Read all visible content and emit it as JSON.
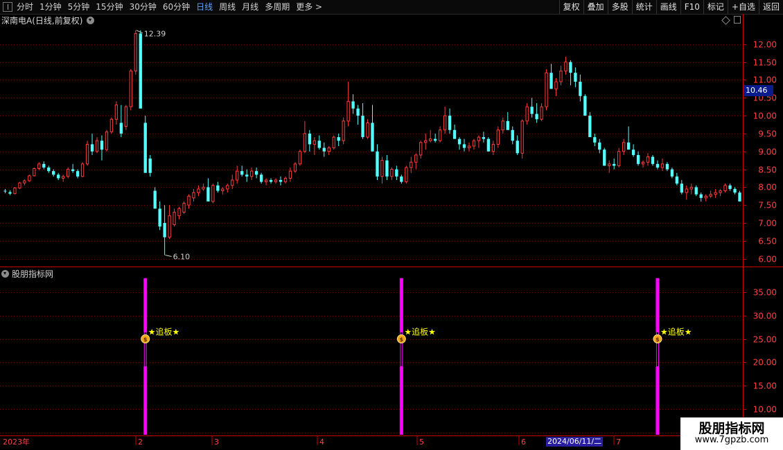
{
  "toolbar": {
    "periods": [
      "分时",
      "1分钟",
      "5分钟",
      "15分钟",
      "30分钟",
      "60分钟",
      "日线",
      "周线",
      "月线",
      "多周期",
      "更多 >"
    ],
    "active_period": "日线",
    "actions": [
      "复权",
      "叠加",
      "多股",
      "统计",
      "画线",
      "F10",
      "标记",
      "+自选",
      "返回"
    ]
  },
  "chart_title": "深南电A(日线,前复权)",
  "indicator_title": "股朋指标网",
  "current_price_badge": "10.46",
  "high_label": "12.39",
  "low_label": "6.10",
  "signal_label": "★追板★",
  "date_badge": "2024/06/11/二",
  "x_labels": [
    "2023年",
    "2",
    "3",
    "4",
    "5",
    "6",
    "7"
  ],
  "watermark": {
    "title": "股朋指标网",
    "url": "www.7gpzb.com"
  },
  "colors": {
    "up": "#ff3b3b",
    "down": "#54ffff",
    "grid": "#7a0000",
    "axis": "#c80000",
    "signal": "#ff00ff",
    "label": "#ffff00"
  },
  "chart_data": [
    {
      "type": "candlestick",
      "title": "深南电A(日线,前复权)",
      "y_ticks": [
        6.0,
        6.5,
        7.0,
        7.5,
        8.0,
        8.5,
        9.0,
        9.5,
        10.0,
        10.5,
        11.0,
        11.5,
        12.0
      ],
      "ylim": [
        5.8,
        12.5
      ],
      "x_ticks": [
        "2023年",
        "2",
        "3",
        "4",
        "5",
        "6",
        "7"
      ],
      "annotations": {
        "high": 12.39,
        "low": 6.1,
        "last_price": 10.46
      },
      "candles": [
        [
          7.9,
          7.95,
          7.83,
          7.88
        ],
        [
          7.86,
          7.91,
          7.78,
          7.82
        ],
        [
          7.82,
          8.0,
          7.8,
          7.98
        ],
        [
          7.98,
          8.15,
          7.95,
          8.12
        ],
        [
          8.12,
          8.22,
          8.05,
          8.18
        ],
        [
          8.18,
          8.35,
          8.15,
          8.32
        ],
        [
          8.32,
          8.55,
          8.3,
          8.52
        ],
        [
          8.52,
          8.7,
          8.48,
          8.65
        ],
        [
          8.65,
          8.72,
          8.5,
          8.55
        ],
        [
          8.55,
          8.6,
          8.4,
          8.45
        ],
        [
          8.45,
          8.5,
          8.3,
          8.35
        ],
        [
          8.35,
          8.4,
          8.2,
          8.25
        ],
        [
          8.25,
          8.35,
          8.15,
          8.3
        ],
        [
          8.3,
          8.55,
          8.25,
          8.5
        ],
        [
          8.5,
          8.65,
          8.4,
          8.45
        ],
        [
          8.45,
          8.5,
          8.25,
          8.3
        ],
        [
          8.3,
          8.7,
          8.28,
          8.65
        ],
        [
          8.65,
          9.3,
          8.6,
          9.2
        ],
        [
          9.2,
          9.5,
          8.9,
          9.0
        ],
        [
          9.0,
          9.4,
          8.95,
          9.3
        ],
        [
          9.3,
          9.45,
          8.75,
          9.05
        ],
        [
          9.05,
          9.6,
          9.0,
          9.55
        ],
        [
          9.55,
          9.95,
          9.5,
          9.9
        ],
        [
          9.9,
          10.4,
          9.75,
          10.3
        ],
        [
          9.8,
          10.3,
          9.4,
          9.5
        ],
        [
          9.7,
          10.3,
          9.6,
          10.25
        ],
        [
          10.25,
          11.3,
          10.15,
          11.25
        ],
        [
          11.25,
          12.39,
          11.15,
          12.3
        ],
        [
          12.3,
          12.39,
          10.5,
          10.2
        ],
        [
          9.8,
          10.0,
          8.5,
          8.4
        ],
        [
          8.8,
          8.9,
          8.3,
          8.4
        ],
        [
          7.9,
          8.0,
          7.4,
          7.4
        ],
        [
          7.4,
          7.6,
          6.8,
          6.9
        ],
        [
          7.0,
          7.5,
          6.1,
          6.6
        ],
        [
          6.6,
          7.5,
          6.55,
          7.2
        ],
        [
          6.95,
          7.4,
          6.9,
          7.3
        ],
        [
          7.2,
          7.45,
          7.1,
          7.4
        ],
        [
          7.3,
          7.6,
          7.25,
          7.55
        ],
        [
          7.5,
          7.8,
          7.4,
          7.75
        ],
        [
          7.7,
          7.95,
          7.6,
          7.85
        ],
        [
          7.85,
          8.05,
          7.75,
          7.95
        ],
        [
          7.95,
          8.1,
          7.9,
          8.0
        ],
        [
          8.0,
          8.25,
          7.95,
          7.6
        ],
        [
          7.6,
          8.1,
          7.55,
          8.05
        ],
        [
          8.05,
          8.15,
          7.85,
          7.9
        ],
        [
          7.9,
          8.0,
          7.8,
          7.95
        ],
        [
          7.95,
          8.1,
          7.85,
          8.05
        ],
        [
          8.05,
          8.35,
          7.95,
          8.2
        ],
        [
          8.2,
          8.6,
          8.1,
          8.45
        ],
        [
          8.45,
          8.6,
          8.3,
          8.35
        ],
        [
          8.35,
          8.5,
          8.15,
          8.3
        ],
        [
          8.3,
          8.55,
          8.2,
          8.45
        ],
        [
          8.45,
          8.55,
          8.25,
          8.35
        ],
        [
          8.35,
          8.4,
          8.1,
          8.15
        ],
        [
          8.15,
          8.25,
          8.05,
          8.2
        ],
        [
          8.2,
          8.25,
          8.1,
          8.15
        ],
        [
          8.15,
          8.25,
          8.1,
          8.2
        ],
        [
          8.2,
          8.3,
          8.05,
          8.15
        ],
        [
          8.15,
          8.3,
          8.1,
          8.25
        ],
        [
          8.25,
          8.55,
          8.15,
          8.45
        ],
        [
          8.45,
          8.7,
          8.4,
          8.65
        ],
        [
          8.65,
          9.05,
          8.6,
          9.0
        ],
        [
          9.0,
          9.85,
          8.95,
          9.5
        ],
        [
          9.5,
          9.6,
          9.0,
          9.2
        ],
        [
          9.2,
          9.4,
          8.9,
          9.3
        ],
        [
          9.3,
          9.45,
          9.05,
          9.1
        ],
        [
          9.1,
          9.25,
          8.85,
          9.0
        ],
        [
          9.0,
          9.15,
          8.9,
          9.1
        ],
        [
          9.1,
          9.45,
          9.05,
          9.4
        ],
        [
          9.4,
          9.5,
          9.15,
          9.3
        ],
        [
          9.3,
          9.95,
          9.2,
          9.85
        ],
        [
          9.85,
          10.95,
          9.7,
          10.4
        ],
        [
          10.4,
          10.6,
          10.05,
          10.2
        ],
        [
          10.2,
          10.3,
          9.75,
          10.0
        ],
        [
          10.0,
          10.35,
          9.35,
          9.4
        ],
        [
          9.4,
          9.9,
          9.35,
          9.8
        ],
        [
          9.8,
          10.3,
          9.0,
          9.0
        ],
        [
          9.0,
          9.2,
          8.2,
          8.3
        ],
        [
          8.3,
          8.85,
          8.1,
          8.75
        ],
        [
          8.75,
          8.9,
          8.2,
          8.3
        ],
        [
          8.3,
          8.55,
          8.2,
          8.5
        ],
        [
          8.5,
          8.6,
          8.2,
          8.3
        ],
        [
          8.3,
          8.35,
          8.1,
          8.15
        ],
        [
          8.15,
          8.6,
          8.1,
          8.55
        ],
        [
          8.55,
          8.85,
          8.4,
          8.7
        ],
        [
          8.7,
          8.95,
          8.5,
          8.9
        ],
        [
          8.9,
          9.3,
          8.8,
          9.25
        ],
        [
          9.25,
          9.5,
          9.05,
          9.3
        ],
        [
          9.3,
          9.6,
          9.25,
          9.35
        ],
        [
          9.35,
          9.5,
          9.25,
          9.3
        ],
        [
          9.3,
          9.7,
          9.25,
          9.6
        ],
        [
          9.6,
          10.25,
          9.5,
          10.0
        ],
        [
          10.0,
          10.2,
          9.5,
          9.6
        ],
        [
          9.6,
          9.75,
          9.4,
          9.35
        ],
        [
          9.35,
          9.4,
          9.05,
          9.2
        ],
        [
          9.2,
          9.35,
          9.0,
          9.1
        ],
        [
          9.1,
          9.25,
          9.0,
          9.15
        ],
        [
          9.15,
          9.35,
          9.05,
          9.3
        ],
        [
          9.3,
          9.45,
          9.1,
          9.4
        ],
        [
          9.4,
          9.55,
          9.25,
          9.35
        ],
        [
          9.35,
          9.4,
          9.0,
          9.0
        ],
        [
          9.0,
          9.3,
          8.9,
          9.2
        ],
        [
          9.2,
          9.7,
          9.1,
          9.6
        ],
        [
          9.6,
          9.95,
          9.5,
          9.85
        ],
        [
          9.85,
          10.1,
          9.7,
          9.6
        ],
        [
          9.6,
          9.7,
          9.2,
          9.3
        ],
        [
          9.3,
          9.45,
          8.9,
          8.95
        ],
        [
          8.95,
          9.9,
          8.8,
          9.85
        ],
        [
          9.85,
          10.35,
          9.75,
          10.25
        ],
        [
          10.25,
          10.5,
          9.95,
          10.05
        ],
        [
          10.05,
          10.35,
          9.8,
          9.9
        ],
        [
          9.9,
          10.35,
          9.85,
          10.25
        ],
        [
          10.25,
          11.3,
          10.15,
          11.2
        ],
        [
          11.2,
          11.45,
          10.8,
          10.75
        ],
        [
          10.75,
          11.05,
          10.55,
          10.95
        ],
        [
          10.95,
          11.4,
          10.85,
          11.25
        ],
        [
          11.25,
          11.65,
          11.15,
          11.5
        ],
        [
          11.5,
          11.55,
          10.85,
          11.2
        ],
        [
          11.2,
          11.35,
          10.8,
          10.95
        ],
        [
          10.95,
          11.15,
          10.4,
          10.55
        ],
        [
          10.55,
          10.6,
          10.0,
          10.0
        ],
        [
          10.0,
          10.1,
          9.4,
          9.4
        ],
        [
          9.4,
          9.5,
          9.15,
          9.25
        ],
        [
          9.25,
          9.35,
          8.95,
          9.05
        ],
        [
          9.05,
          9.1,
          8.6,
          8.6
        ],
        [
          8.6,
          8.75,
          8.4,
          8.65
        ],
        [
          8.65,
          8.8,
          8.5,
          8.6
        ],
        [
          8.6,
          9.1,
          8.55,
          9.0
        ],
        [
          9.0,
          9.35,
          8.9,
          9.25
        ],
        [
          9.25,
          9.7,
          9.15,
          9.05
        ],
        [
          9.05,
          9.2,
          8.85,
          8.9
        ],
        [
          8.9,
          9.0,
          8.6,
          8.65
        ],
        [
          8.65,
          8.75,
          8.55,
          8.7
        ],
        [
          8.7,
          8.95,
          8.6,
          8.85
        ],
        [
          8.85,
          8.9,
          8.6,
          8.65
        ],
        [
          8.65,
          8.75,
          8.5,
          8.55
        ],
        [
          8.55,
          8.8,
          8.45,
          8.65
        ],
        [
          8.65,
          8.7,
          8.45,
          8.5
        ],
        [
          8.5,
          8.55,
          8.25,
          8.3
        ],
        [
          8.3,
          8.4,
          8.05,
          8.1
        ],
        [
          8.1,
          8.2,
          7.8,
          7.85
        ],
        [
          7.85,
          8.05,
          7.65,
          7.95
        ],
        [
          7.95,
          8.1,
          7.8,
          8.0
        ],
        [
          8.0,
          8.05,
          7.75,
          7.8
        ],
        [
          7.8,
          7.85,
          7.6,
          7.7
        ],
        [
          7.7,
          7.8,
          7.6,
          7.75
        ],
        [
          7.75,
          7.9,
          7.7,
          7.8
        ],
        [
          7.8,
          7.95,
          7.7,
          7.85
        ],
        [
          7.85,
          7.95,
          7.75,
          7.9
        ],
        [
          7.9,
          8.1,
          7.85,
          8.05
        ],
        [
          8.05,
          8.1,
          7.9,
          7.95
        ],
        [
          7.95,
          8.0,
          7.8,
          7.85
        ],
        [
          7.85,
          7.9,
          7.6,
          7.6
        ]
      ]
    },
    {
      "type": "bar",
      "title": "股朋指标网",
      "y_ticks": [
        5.0,
        10.0,
        15.0,
        20.0,
        25.0,
        30.0,
        35.0
      ],
      "ylim": [
        4.5,
        39
      ],
      "signal_value": 38,
      "signal_marker_value": 25,
      "signal_indices": [
        29,
        82,
        135
      ],
      "signal_label": "★追板★"
    }
  ]
}
